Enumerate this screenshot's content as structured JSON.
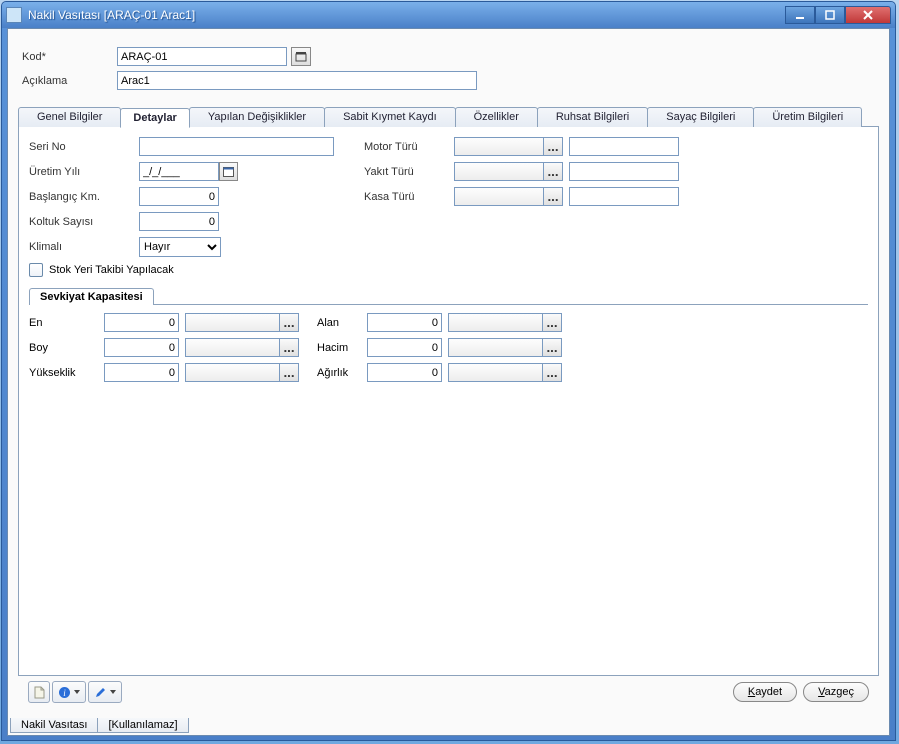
{
  "window": {
    "title": "Nakil Vasıtası [ARAÇ-01 Arac1]"
  },
  "header": {
    "kod_label": "Kod*",
    "kod_value": "ARAÇ-01",
    "aciklama_label": "Açıklama",
    "aciklama_value": "Arac1"
  },
  "tabs": {
    "t0": "Genel Bilgiler",
    "t1": "Detaylar",
    "t2": "Yapılan Değişiklikler",
    "t3": "Sabit Kıymet Kaydı",
    "t4": "Özellikler",
    "t5": "Ruhsat Bilgileri",
    "t6": "Sayaç Bilgileri",
    "t7": "Üretim Bilgileri"
  },
  "detay": {
    "seri_no_label": "Seri No",
    "seri_no_value": "",
    "uretim_yili_label": "Üretim Yılı",
    "uretim_yili_value": "_/_/___",
    "baslangic_km_label": "Başlangıç Km.",
    "baslangic_km_value": "0",
    "koltuk_sayisi_label": "Koltuk Sayısı",
    "koltuk_sayisi_value": "0",
    "klimali_label": "Klimalı",
    "klimali_value": "Hayır",
    "stok_takip_label": "Stok Yeri Takibi Yapılacak",
    "motor_turu_label": "Motor Türü",
    "yakit_turu_label": "Yakıt Türü",
    "kasa_turu_label": "Kasa Türü"
  },
  "sevkiyat": {
    "title": "Sevkiyat Kapasitesi",
    "en_label": "En",
    "en_value": "0",
    "boy_label": "Boy",
    "boy_value": "0",
    "yukseklik_label": "Yükseklik",
    "yukseklik_value": "0",
    "alan_label": "Alan",
    "alan_value": "0",
    "hacim_label": "Hacim",
    "hacim_value": "0",
    "agirlik_label": "Ağırlık",
    "agirlik_value": "0"
  },
  "buttons": {
    "kaydet": "Kaydet",
    "vazgec": "Vazgeç",
    "lookup": "..."
  },
  "footer_tabs": {
    "ft0": "Nakil Vasıtası",
    "ft1": "[Kullanılamaz]"
  }
}
